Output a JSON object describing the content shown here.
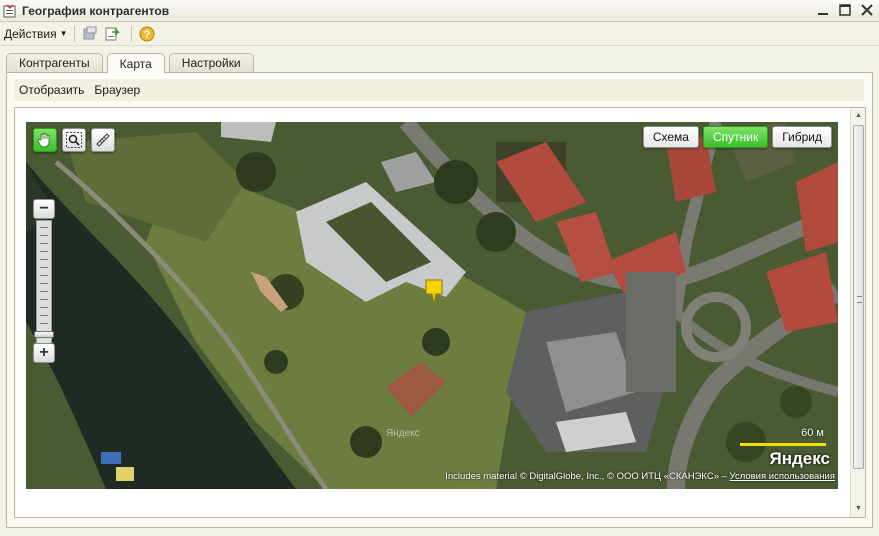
{
  "window": {
    "title": "География контрагентов",
    "icon": "form-icon"
  },
  "toolbar": {
    "actions_label": "Действия",
    "icons": [
      "move-icon",
      "export-icon",
      "help-icon"
    ]
  },
  "tabs": [
    {
      "label": "Контрагенты",
      "active": false
    },
    {
      "label": "Карта",
      "active": true
    },
    {
      "label": "Настройки",
      "active": false
    }
  ],
  "subbar": {
    "show_label": "Отобразить",
    "browser_label": "Браузер"
  },
  "map": {
    "layer_buttons": [
      {
        "label": "Схема",
        "active": false
      },
      {
        "label": "Спутник",
        "active": true
      },
      {
        "label": "Гибрид",
        "active": false
      }
    ],
    "tools": [
      "hand-icon",
      "zoom-rect-icon",
      "ruler-icon"
    ],
    "watermark": "Яндекс",
    "scale_label": "60 м",
    "logo": "Яндекс",
    "copyright_text": "Includes material © DigitalGlobe, Inc., © ООО ИТЦ «СКАНЭКС» –",
    "copyright_link": "Условия использования",
    "colors": {
      "accent_green": "#3bbf2c",
      "marker": "#f5d400",
      "scale_bar": "#f4e000"
    }
  }
}
